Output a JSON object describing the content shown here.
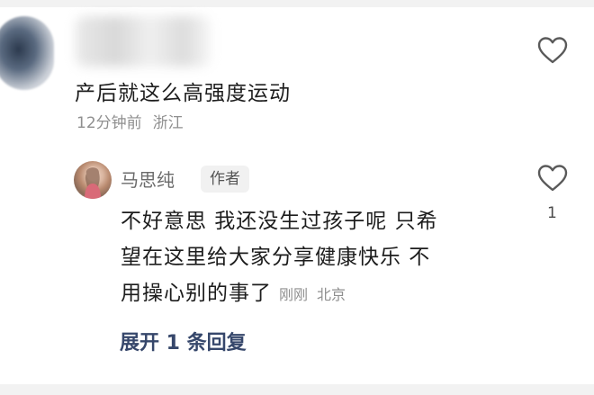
{
  "comment": {
    "text": "产后就这么高强度运动",
    "time": "12分钟前",
    "location": "浙江"
  },
  "reply": {
    "author": "马思纯",
    "badge": "作者",
    "text_lines": [
      "不好意思 我还没生过孩子呢 只希",
      "望在这里给大家分享健康快乐 不",
      "用操心别的事了"
    ],
    "time": "刚刚",
    "location": "北京",
    "likes": "1"
  },
  "expand": {
    "label": "展开 1 条回复"
  },
  "icons": {
    "like": "heart-outline-icon"
  },
  "colors": {
    "text": "#1d1d1d",
    "meta": "#8f8f8f",
    "expand_link": "#36476b"
  }
}
